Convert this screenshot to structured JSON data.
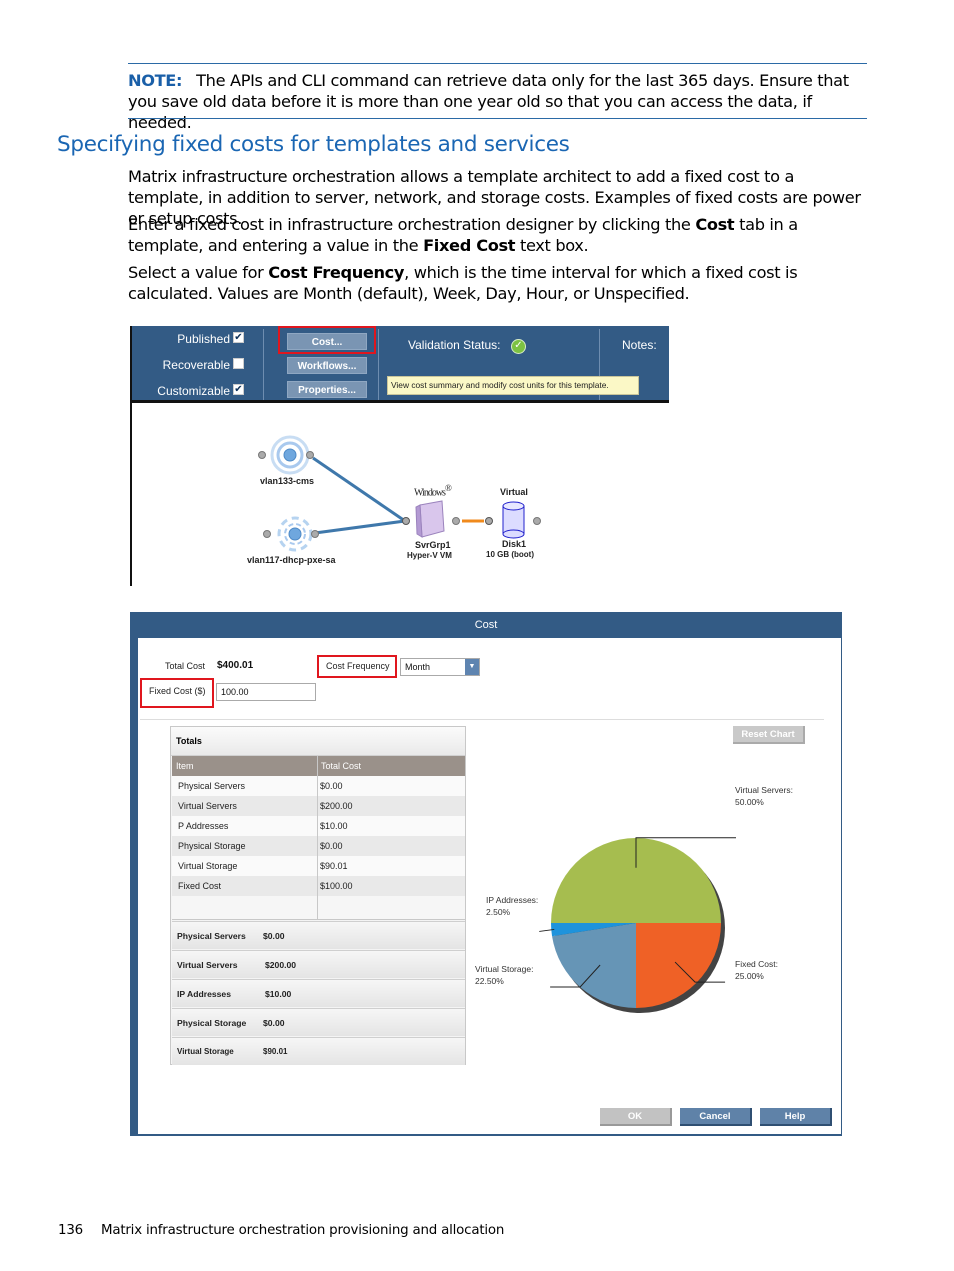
{
  "note": {
    "label": "NOTE:",
    "text": "The APIs and CLI command can retrieve data only for the last 365 days. Ensure that you save old data before it is more than one year old so that you can access the data, if needed."
  },
  "section": {
    "title": "Specifying fixed costs for templates and services"
  },
  "paragraphs": {
    "p1": "Matrix infrastructure orchestration allows a template architect to add a fixed cost to a template, in addition to server, network, and storage costs. Examples of fixed costs are power or setup costs.",
    "p2_pre": "Enter a fixed cost in infrastructure orchestration designer by clicking the ",
    "p2_bold1": "Cost",
    "p2_mid": " tab in a template, and entering a value in the ",
    "p2_bold2": "Fixed Cost",
    "p2_post": " text box.",
    "p3_pre": "Select a value for ",
    "p3_bold": "Cost Frequency",
    "p3_post": ", which is the time interval for which a fixed cost is calculated. Values are Month (default), Week, Day, Hour, or Unspecified."
  },
  "designer": {
    "checkboxes": [
      {
        "label": "Published",
        "checked": true,
        "mark": "✔"
      },
      {
        "label": "Recoverable",
        "checked": false,
        "mark": ""
      },
      {
        "label": "Customizable",
        "checked": true,
        "mark": "✔"
      }
    ],
    "buttons": {
      "cost": "Cost...",
      "workflows": "Workflows...",
      "properties": "Properties..."
    },
    "validation_label": "Validation Status:",
    "validation_icon": "check-circle-icon",
    "notes_label": "Notes:",
    "tooltip": "View cost summary and modify cost units for this template.",
    "nodes": {
      "vlan1": "vlan133-cms",
      "vlan2": "vlan117-dhcp-pxe-sa",
      "windows_brand": "Windows",
      "windows_reg": "®",
      "server_name": "SvrGrp1",
      "server_type": "Hyper-V VM",
      "disk_header": "Virtual",
      "disk_name": "Disk1",
      "disk_size": "10 GB (boot)"
    }
  },
  "cost_dialog": {
    "title": "Cost",
    "total_cost_label": "Total Cost",
    "total_cost_value": "$400.01",
    "cost_frequency_label": "Cost Frequency",
    "cost_frequency_value": "Month",
    "fixed_cost_label": "Fixed Cost ($)",
    "fixed_cost_value": "100.00",
    "totals": {
      "header": "Totals",
      "columns": [
        "Item",
        "Total Cost"
      ],
      "rows": [
        {
          "item": "Physical Servers",
          "cost": "$0.00"
        },
        {
          "item": "Virtual Servers",
          "cost": "$200.00"
        },
        {
          "item": "P Addresses",
          "cost": "$10.00"
        },
        {
          "item": "Physical Storage",
          "cost": "$0.00"
        },
        {
          "item": "Virtual Storage",
          "cost": "$90.01"
        },
        {
          "item": "Fixed Cost",
          "cost": "$100.00"
        }
      ],
      "summary": [
        {
          "item": "Physical Servers",
          "cost": "$0.00"
        },
        {
          "item": "Virtual Servers",
          "cost": "$200.00"
        },
        {
          "item": "IP Addresses",
          "cost": "$10.00"
        },
        {
          "item": "Physical Storage",
          "cost": "$0.00"
        },
        {
          "item": "Virtual Storage",
          "cost": "$90.01"
        }
      ]
    },
    "reset_chart": "Reset Chart",
    "buttons": {
      "ok": "OK",
      "cancel": "Cancel",
      "help": "Help"
    }
  },
  "chart_data": {
    "type": "pie",
    "title": "",
    "slices": [
      {
        "label": "Virtual Servers:",
        "value": 50.0,
        "text": "50.00%",
        "color": "#a6bd4f"
      },
      {
        "label": "Fixed Cost:",
        "value": 25.0,
        "text": "25.00%",
        "color": "#ef6126"
      },
      {
        "label": "Virtual Storage:",
        "value": 22.5,
        "text": "22.50%",
        "color": "#6695b6"
      },
      {
        "label": "IP Addresses:",
        "value": 2.5,
        "text": "2.50%",
        "color": "#1e93dc"
      }
    ]
  },
  "footer": {
    "page_number": "136",
    "chapter": "Matrix infrastructure orchestration provisioning and allocation"
  }
}
